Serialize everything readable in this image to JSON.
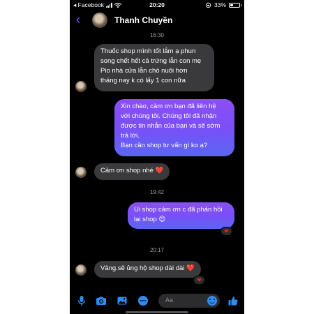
{
  "status_bar": {
    "back_app": "◂ Facebook",
    "time": "20:20",
    "battery": "33%",
    "battery_level": 0.33
  },
  "header": {
    "contact_name": "Thanh Chuyền",
    "back_icon": "chevron-left-icon",
    "accent_color": "#8b5cf6"
  },
  "chat": {
    "timestamps": [
      "16:30",
      "19:42",
      "20:17"
    ],
    "messages": [
      {
        "direction": "incoming",
        "lines": [
          "Thuốc shop mình tốt lắm ạ phun",
          "song chết hết cả trứng lẫn con mẹ",
          "Pio nhà cửa lẫn chó nuôi hơn",
          "tháng  nay k có lấy 1 con nữa"
        ]
      },
      {
        "direction": "outgoing",
        "lines": [
          "Xin chào, cảm ơn bạn đã liên hệ",
          "với chúng tôi. Chúng tôi đã nhận",
          "được tin nhắn của bạn và sẽ sớm",
          "trả lời.",
          "Bạn cần shop tư vấn gì ko ạ?"
        ]
      },
      {
        "direction": "incoming",
        "lines": [
          "Cảm ơn shop nhé ❤️"
        ]
      },
      {
        "direction": "outgoing",
        "lines": [
          "Ui shop cảm ơn c đã phản hồi",
          "lại shop 😍"
        ],
        "reaction": "❤"
      },
      {
        "direction": "incoming",
        "lines": [
          "Vâng.sẽ ủng hộ shop dài dài ❤️"
        ],
        "reaction": "❤"
      }
    ]
  },
  "composer": {
    "placeholder": "Aa",
    "icons": [
      "microphone-icon",
      "camera-icon",
      "image-icon",
      "messenger-icon",
      "emoji-icon",
      "like-thumb-icon"
    ]
  },
  "colors": {
    "background": "#000000",
    "incoming_bubble": "#3a3a3c",
    "outgoing_bubble_top": "#8b4ff5",
    "outgoing_bubble_bottom": "#5a66f4",
    "icon_blue": "#2f8cf0"
  }
}
